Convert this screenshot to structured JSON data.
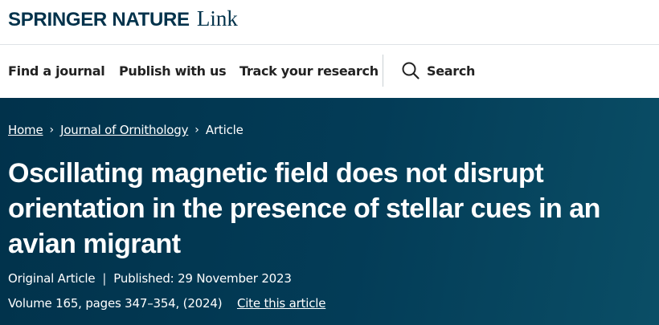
{
  "brand": {
    "primary": "SPRINGER NATURE",
    "secondary": "Link"
  },
  "nav": {
    "items": [
      "Find a journal",
      "Publish with us",
      "Track your research"
    ],
    "search_label": "Search"
  },
  "breadcrumb": {
    "home": "Home",
    "journal": "Journal of Ornithology",
    "current": "Article",
    "separator": "›"
  },
  "article": {
    "title": "Oscillating magnetic field does not disrupt orientation in the presence of stellar cues in an avian migrant",
    "type": "Original Article",
    "meta_separator": "|",
    "published": "Published: 29 November 2023",
    "volume_info": "Volume 165, pages 347–354, (2024)",
    "cite_label": "Cite this article"
  },
  "colors": {
    "brand": "#01324b",
    "hero_bg": "#01324b",
    "hero_text": "#ffffff"
  },
  "icons": {
    "search": "search-icon"
  }
}
